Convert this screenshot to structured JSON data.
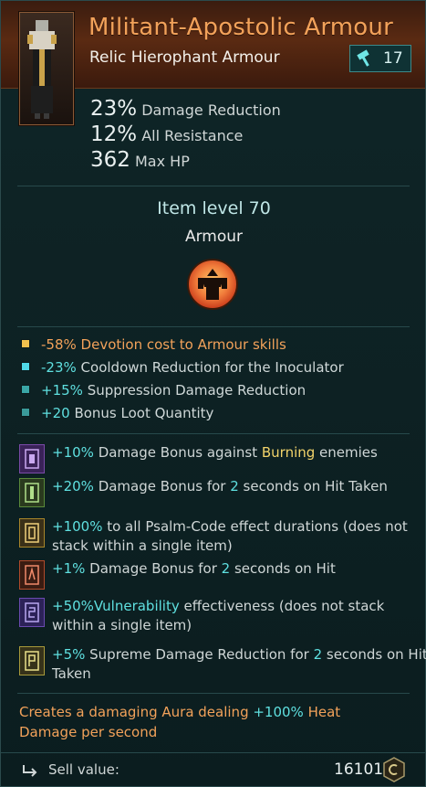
{
  "item": {
    "name": "Militant-Apostolic Armour",
    "base_type": "Relic Hierophant Armour",
    "upgrade_level": "17"
  },
  "stats": [
    {
      "value": "23%",
      "label": "Damage Reduction"
    },
    {
      "value": "12%",
      "label": "All Resistance"
    },
    {
      "value": "362",
      "label": "Max HP"
    }
  ],
  "item_level": "Item level 70",
  "item_type": "Armour",
  "affixes": [
    {
      "value": "-58%",
      "text": "Devotion cost to Armour skills",
      "color": "#f2c14e"
    },
    {
      "value": "-23%",
      "text": "Cooldown Reduction for the Inoculator",
      "color": "#4fd8e8"
    },
    {
      "value": "+15%",
      "text": "Suppression Damage Reduction",
      "color": "#3aa6a6"
    },
    {
      "value": "+20",
      "text": "Bonus Loot Quantity",
      "color": "#3a9a9a"
    }
  ],
  "psalms": [
    {
      "pre": "+10%",
      "a": " Damage Bonus against ",
      "hl": "Burning",
      "b": " enemies",
      "icon_color": "#7a4aa8"
    },
    {
      "pre": "+20%",
      "a": " Damage Bonus for ",
      "hl": "2",
      "b": " seconds on Hit Taken",
      "icon_color": "#5a8a3a"
    },
    {
      "pre": "+100%",
      "a": " to all Psalm-Code effect durations (does not stack within a single item)",
      "hl": "",
      "b": "",
      "icon_color": "#a8862a"
    },
    {
      "pre": "+1%",
      "a": " Damage Bonus for ",
      "hl": "2",
      "b": " seconds on Hit",
      "icon_color": "#b04a2a"
    },
    {
      "pre": "+50%",
      "a": "",
      "hl": "Vulnerability",
      "b": " effectiveness (does not stack within a single item)",
      "icon_color": "#6a4ab0"
    },
    {
      "pre": "+5%",
      "a": " Supreme Damage Reduction for ",
      "hl": "2",
      "b": " seconds on Hit Taken",
      "icon_color": "#a89a3a"
    }
  ],
  "aura": {
    "a": "Creates a damaging Aura dealing ",
    "v": "+100%",
    "b": " Heat Damage per second"
  },
  "sell": {
    "label": "Sell value:",
    "value": "16101"
  }
}
